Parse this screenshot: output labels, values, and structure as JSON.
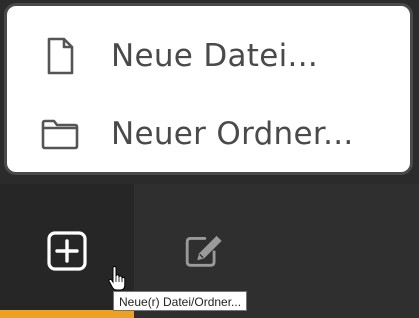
{
  "menu": {
    "items": [
      {
        "label": "Neue Datei...",
        "icon": "file-icon"
      },
      {
        "label": "Neuer Ordner...",
        "icon": "folder-icon"
      }
    ]
  },
  "toolbar": {
    "buttons": [
      {
        "icon": "plus-square-icon",
        "active": true
      },
      {
        "icon": "edit-icon",
        "active": false
      }
    ],
    "accent_color": "#f0a020"
  },
  "tooltip": {
    "text": "Neue(r) Datei/Ordner..."
  }
}
